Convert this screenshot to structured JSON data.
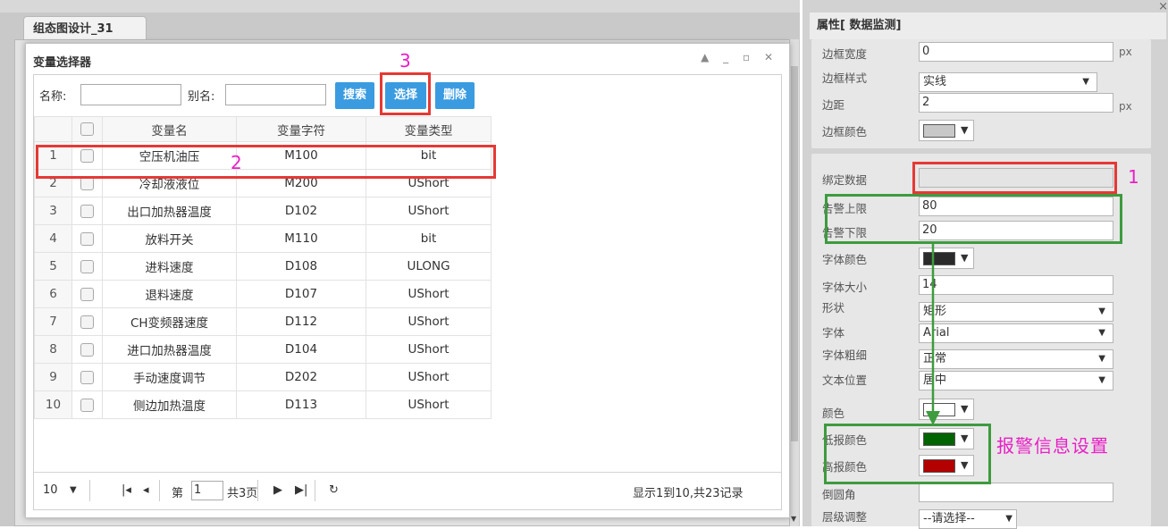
{
  "editor": {
    "tab_label": "组态图设计_31"
  },
  "dialog": {
    "title": "变量选择器",
    "controls": "▲ _ ▫ ✕",
    "search": {
      "name_label": "名称:",
      "alias_label": "别名:",
      "search_button": "搜索",
      "select_button": "选择",
      "delete_button": "删除"
    },
    "columns": [
      "",
      "",
      "变量名",
      "变量字符",
      "变量类型"
    ],
    "rows": [
      {
        "n": "1",
        "name": "空压机油压",
        "sym": "M100",
        "type": "bit"
      },
      {
        "n": "2",
        "name": "冷却液液位",
        "sym": "M200",
        "type": "UShort"
      },
      {
        "n": "3",
        "name": "出口加热器温度",
        "sym": "D102",
        "type": "UShort"
      },
      {
        "n": "4",
        "name": "放料开关",
        "sym": "M110",
        "type": "bit"
      },
      {
        "n": "5",
        "name": "进料速度",
        "sym": "D108",
        "type": "ULONG"
      },
      {
        "n": "6",
        "name": "退料速度",
        "sym": "D107",
        "type": "UShort"
      },
      {
        "n": "7",
        "name": "CH变频器速度",
        "sym": "D112",
        "type": "UShort"
      },
      {
        "n": "8",
        "name": "进口加热器温度",
        "sym": "D104",
        "type": "UShort"
      },
      {
        "n": "9",
        "name": "手动速度调节",
        "sym": "D202",
        "type": "UShort"
      },
      {
        "n": "10",
        "name": "侧边加热温度",
        "sym": "D113",
        "type": "UShort"
      }
    ],
    "pager": {
      "page_size": "10",
      "page_prefix": "第",
      "page_value": "1",
      "total_pages": "共3页",
      "summary": "显示1到10,共23记录"
    }
  },
  "props": {
    "header": "属性[  数据监测]",
    "close": "×",
    "border_width_label": "边框宽度",
    "border_width": "0",
    "border_width_unit": "px",
    "border_style_label": "边框样式",
    "border_style": "实线",
    "margin_label": "边距",
    "margin": "2",
    "margin_unit": "px",
    "border_color_label": "边框颜色",
    "bind_label": "绑定数据",
    "bind_value": "",
    "alarm_high_label": "告警上限",
    "alarm_high": "80",
    "alarm_low_label": "告警下限",
    "alarm_low": "20",
    "font_color_label": "字体颜色",
    "font_size_label": "字体大小",
    "font_size": "14",
    "shape_label": "形状",
    "shape": "矩形",
    "font_label": "字体",
    "font": "Arial",
    "font_weight_label": "字体粗细",
    "font_weight": "正常",
    "text_pos_label": "文本位置",
    "text_pos": "居中",
    "color_label": "颜色",
    "low_color_label": "低报颜色",
    "high_color_label": "高报颜色",
    "radius_label": "倒圆角",
    "radius": "",
    "layer_label": "层级调整",
    "layer": "--请选择--"
  },
  "colors": {
    "border_color": "#c8c8c8",
    "font_color": "#2b2b2b",
    "color": "#ffffff",
    "low_color": "#006400",
    "high_color": "#b30000",
    "button_blue": "#3a9be0"
  },
  "annotations": {
    "n1": "1",
    "n2": "2",
    "n3": "3",
    "alarm_text": "报警信息设置"
  }
}
